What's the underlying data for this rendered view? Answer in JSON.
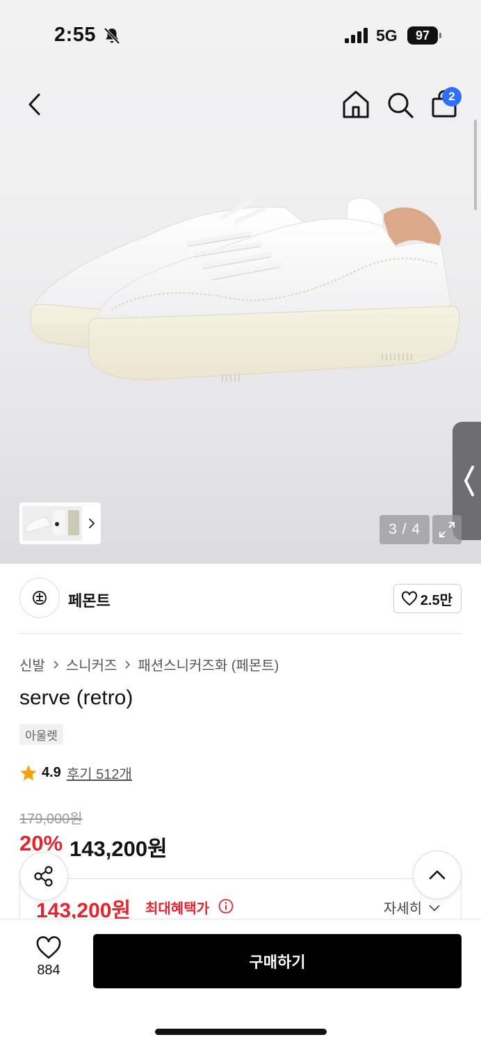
{
  "status_bar": {
    "time": "2:55",
    "network": "5G",
    "battery": "97"
  },
  "nav": {
    "cart_count": "2"
  },
  "gallery": {
    "counter": "3 / 4"
  },
  "brand": {
    "name": "페몬트",
    "likes": "2.5만"
  },
  "breadcrumb": [
    "신발",
    "스니커즈",
    "패션스니커즈화 (페몬트)"
  ],
  "product": {
    "title": "serve (retro)",
    "tag": "아울렛",
    "rating": "4.9",
    "reviews_label": "후기 512개",
    "original_price": "179,000원",
    "discount": "20%",
    "sale_price": "143,200원"
  },
  "benefit": {
    "price": "143,200원",
    "label": "최대혜택가",
    "detail": "자세히"
  },
  "bottom_bar": {
    "wish_count": "884",
    "buy_label": "구매하기"
  },
  "colors": {
    "accent_red": "#e8222e",
    "badge_blue": "#2f6ef6",
    "buy_button": "#000000"
  }
}
